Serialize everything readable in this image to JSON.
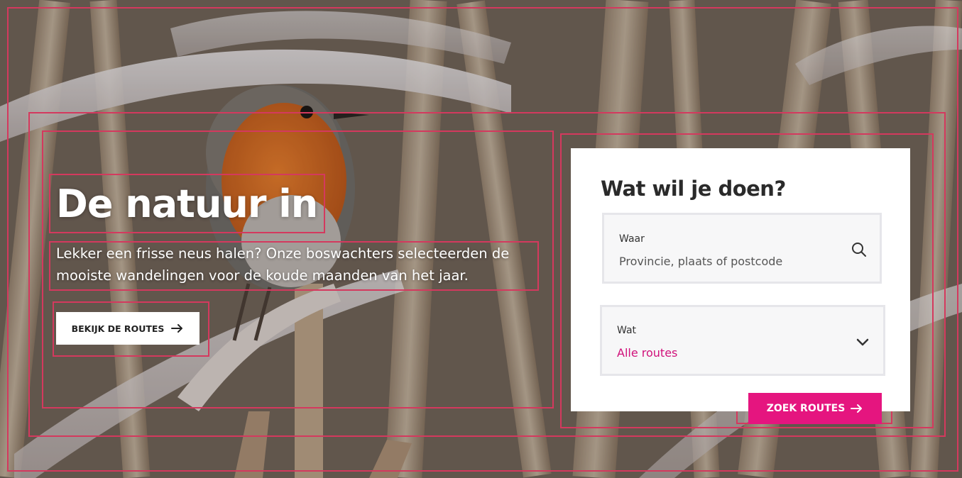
{
  "hero": {
    "title": "De natuur in",
    "intro": "Lekker een frisse neus halen? Onze boswachters selecteerden de mooiste wandelingen voor de koude maanden van het jaar.",
    "cta_label": "BEKIJK DE ROUTES"
  },
  "search": {
    "title": "Wat wil je doen?",
    "where_label": "Waar",
    "where_placeholder": "Provincie, plaats of postcode",
    "what_label": "Wat",
    "what_value": "Alle routes",
    "submit_label": "ZOEK ROUTES"
  },
  "icons": {
    "cta_arrow": "arrow-right-icon",
    "where_icon": "search-icon",
    "what_icon": "chevron-down-icon",
    "submit_arrow": "arrow-right-icon"
  },
  "colors": {
    "accent": "#e5157f",
    "selected_value": "#d0117a",
    "outline": "#d4395e",
    "card_bg": "#ffffff",
    "field_bg": "#f7f7f8"
  }
}
